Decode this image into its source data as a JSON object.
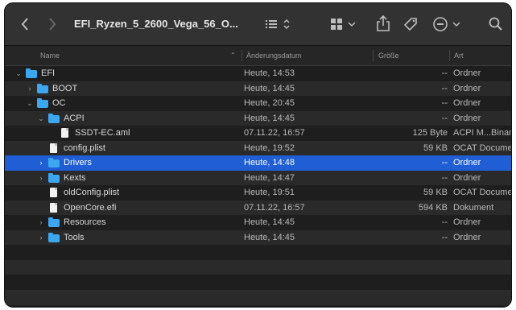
{
  "toolbar": {
    "title": "EFI_Ryzen_5_2600_Vega_56_O...",
    "back_icon": "chevron-left-icon",
    "forward_icon": "chevron-right-icon",
    "list_view_icon": "list-view-icon",
    "group_icon": "grid-group-icon",
    "share_icon": "share-icon",
    "tag_icon": "tag-icon",
    "more_icon": "ellipsis-circle-icon",
    "search_icon": "search-icon"
  },
  "columns": {
    "name": "Name",
    "date": "Änderungsdatum",
    "size": "Größe",
    "kind": "Art"
  },
  "rows": [
    {
      "name": "EFI",
      "date": "Heute, 14:53",
      "size": "--",
      "kind": "Ordner",
      "type": "folder",
      "level": 0,
      "expanded": true
    },
    {
      "name": "BOOT",
      "date": "Heute, 14:45",
      "size": "--",
      "kind": "Ordner",
      "type": "folder",
      "level": 1,
      "expanded": false
    },
    {
      "name": "OC",
      "date": "Heute, 20:45",
      "size": "--",
      "kind": "Ordner",
      "type": "folder",
      "level": 1,
      "expanded": true
    },
    {
      "name": "ACPI",
      "date": "Heute, 14:45",
      "size": "--",
      "kind": "Ordner",
      "type": "folder",
      "level": 2,
      "expanded": true
    },
    {
      "name": "SSDT-EC.aml",
      "date": "07.11.22, 16:57",
      "size": "125 Byte",
      "kind": "ACPI M...Binary",
      "type": "file",
      "level": 3
    },
    {
      "name": "config.plist",
      "date": "Heute, 19:52",
      "size": "59 KB",
      "kind": "OCAT Document",
      "type": "file",
      "level": 2
    },
    {
      "name": "Drivers",
      "date": "Heute, 14:48",
      "size": "--",
      "kind": "Ordner",
      "type": "folder",
      "level": 2,
      "expanded": false,
      "selected": true
    },
    {
      "name": "Kexts",
      "date": "Heute, 14:47",
      "size": "--",
      "kind": "Ordner",
      "type": "folder",
      "level": 2,
      "expanded": false
    },
    {
      "name": "oldConfig.plist",
      "date": "Heute, 19:51",
      "size": "59 KB",
      "kind": "OCAT Document",
      "type": "file",
      "level": 2
    },
    {
      "name": "OpenCore.efi",
      "date": "07.11.22, 16:57",
      "size": "594 KB",
      "kind": "Dokument",
      "type": "file",
      "level": 2
    },
    {
      "name": "Resources",
      "date": "Heute, 14:45",
      "size": "--",
      "kind": "Ordner",
      "type": "folder",
      "level": 2,
      "expanded": false
    },
    {
      "name": "Tools",
      "date": "Heute, 14:45",
      "size": "--",
      "kind": "Ordner",
      "type": "folder",
      "level": 2,
      "expanded": false
    }
  ],
  "colors": {
    "window_bg": "#1e1e1e",
    "toolbar_bg": "#323232",
    "selection": "#1f5ed4",
    "folder": "#3aa7f0"
  }
}
